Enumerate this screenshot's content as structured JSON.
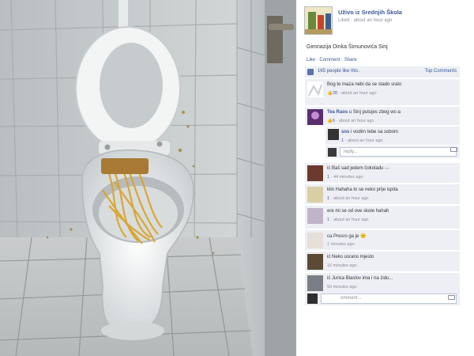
{
  "post": {
    "page_name": "Uživo iz Srednjih Škola",
    "meta": "Liked · about an hour ago",
    "caption": "Gimnazija Dinka Šimunovića Sinj",
    "actions": [
      "Like",
      "Comment",
      "Share"
    ],
    "likes_text": "165 people like this.",
    "top_comments_label": "Top Comments"
  },
  "comments": [
    {
      "name": "",
      "text": "Bog te maza nebi da se stado sralo",
      "likes": "28",
      "time": "about an hour ago"
    },
    {
      "name": "Tea Raos",
      "text": "u Sinj putujes zbog wc-a",
      "likes": "6",
      "time": "about an hour ago"
    },
    {
      "name": "sos",
      "text": "i vodim tebe sa sobom",
      "likes": "1",
      "time": "about an hour ago"
    },
    {
      "name": "",
      "text": "ić Baš sad jedem čokoladu -.-",
      "likes": "1",
      "time": "44 minutes ago"
    },
    {
      "name": "",
      "text": "klin Hahaha to se neko prije ispita",
      "likes": "1",
      "time": "about an hour ago"
    },
    {
      "name": "",
      "text": "ere mi se od ove skole hahah",
      "likes": "1",
      "time": "about an hour ago"
    },
    {
      "name": "",
      "text": "ca Presro ga je 😐",
      "likes": "",
      "time": "1 minutes ago"
    },
    {
      "name": "",
      "text": "ić Neko usrano mjesto",
      "likes": "",
      "time": "16 minutes ago"
    },
    {
      "name": "",
      "text": "ić Jurica Blaslov ima i na zidu...",
      "likes": "",
      "time": "50 minutes ago"
    }
  ],
  "reply_placeholder": "reply...",
  "comment_placeholder": "omment...",
  "colors": {
    "link": "#3b5998",
    "panel_bg": "#edeff4",
    "wall": "#cfd3d4"
  },
  "icons": [
    "thumbs-up-icon",
    "camera-icon"
  ]
}
